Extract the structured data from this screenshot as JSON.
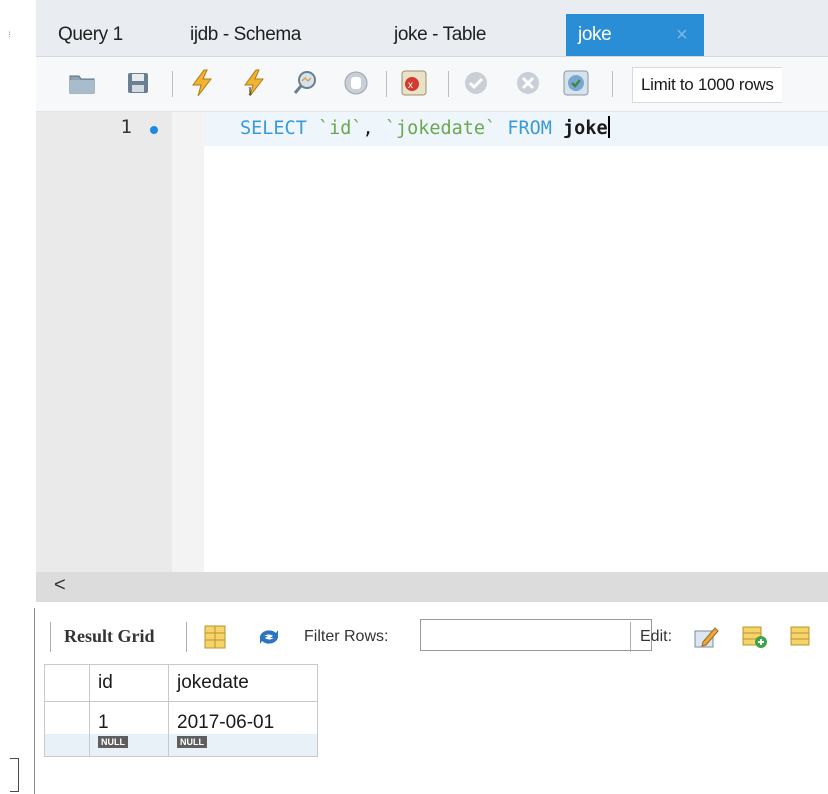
{
  "tabs": [
    {
      "label": "Query 1"
    },
    {
      "label": "ijdb - Schema"
    },
    {
      "label": "joke - Table"
    },
    {
      "label": "joke",
      "active": true
    }
  ],
  "tab_close_glyph": "×",
  "toolbar": {
    "icons": [
      "open-folder-icon",
      "save-icon",
      "execute-icon",
      "execute-current-icon",
      "explain-icon",
      "stop-icon",
      "toggle-error-icon",
      "commit-icon",
      "rollback-icon",
      "autocommit-icon"
    ],
    "limit_label": "Limit to 1000 rows"
  },
  "editor": {
    "line_number": "1",
    "query": {
      "kw1": "SELECT",
      "col1": "`id`",
      "comma": ",",
      "col2": "`jokedate`",
      "kw2": "FROM",
      "table": "joke"
    }
  },
  "scroll": {
    "left_arrow": "<"
  },
  "results": {
    "tab_label": "Result Grid",
    "filter_label": "Filter Rows:",
    "filter_value": "",
    "edit_label": "Edit:",
    "columns": [
      "id",
      "jokedate"
    ],
    "rows": [
      {
        "id": "1",
        "jokedate": "2017-06-01"
      }
    ],
    "new_row": {
      "id": "NULL",
      "jokedate": "NULL"
    }
  },
  "colors": {
    "active_tab": "#2a8ed6",
    "keyword": "#3a9ad9",
    "string": "#6aa84f"
  }
}
